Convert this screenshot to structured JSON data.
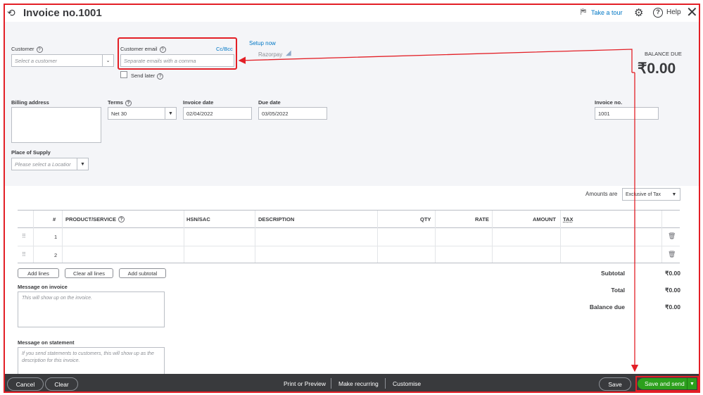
{
  "header": {
    "title": "Invoice no.1001",
    "take_tour": "Take a tour",
    "help": "Help"
  },
  "customer": {
    "label": "Customer",
    "placeholder": "Select a customer"
  },
  "email": {
    "label": "Customer email",
    "cc_bcc": "Cc/Bcc",
    "placeholder": "Separate emails with a comma",
    "send_later": "Send later"
  },
  "payment": {
    "setup_now": "Setup now",
    "provider": "Razorpay"
  },
  "balance": {
    "label": "BALANCE DUE",
    "value": "₹0.00"
  },
  "billing": {
    "label": "Billing address"
  },
  "terms": {
    "label": "Terms",
    "value": "Net 30"
  },
  "invoice_date": {
    "label": "Invoice date",
    "value": "02/04/2022"
  },
  "due_date": {
    "label": "Due date",
    "value": "03/05/2022"
  },
  "invoice_no": {
    "label": "Invoice no.",
    "value": "1001"
  },
  "place_of_supply": {
    "label": "Place of Supply",
    "placeholder": "Please select a Location"
  },
  "amounts": {
    "label": "Amounts are",
    "value": "Exclusive of Tax"
  },
  "table": {
    "headers": [
      "#",
      "PRODUCT/SERVICE",
      "HSN/SAC",
      "DESCRIPTION",
      "QTY",
      "RATE",
      "AMOUNT",
      "TAX"
    ],
    "rows": [
      "1",
      "2"
    ]
  },
  "line_buttons": {
    "add_lines": "Add lines",
    "clear_all": "Clear all lines",
    "add_subtotal": "Add subtotal"
  },
  "totals": {
    "subtotal_label": "Subtotal",
    "subtotal": "₹0.00",
    "total_label": "Total",
    "total": "₹0.00",
    "balance_due_label": "Balance due",
    "balance_due": "₹0.00"
  },
  "message_invoice": {
    "label": "Message on invoice",
    "placeholder": "This will show up on the invoice."
  },
  "message_statement": {
    "label": "Message on statement",
    "placeholder": "If you send statements to customers, this will show up as the description for this invoice."
  },
  "footer": {
    "cancel": "Cancel",
    "clear": "Clear",
    "print": "Print or Preview",
    "recurring": "Make recurring",
    "customise": "Customise",
    "save": "Save",
    "save_send": "Save and send"
  },
  "colors": {
    "accent": "#2ca01c",
    "link": "#0077c5",
    "annotation": "#e31f26",
    "footer": "#393a3d"
  },
  "icons": [
    "history-icon",
    "take-tour-icon",
    "gear-icon",
    "help-icon",
    "close-icon",
    "trash-icon",
    "grip-icon",
    "razorpay-icon"
  ]
}
